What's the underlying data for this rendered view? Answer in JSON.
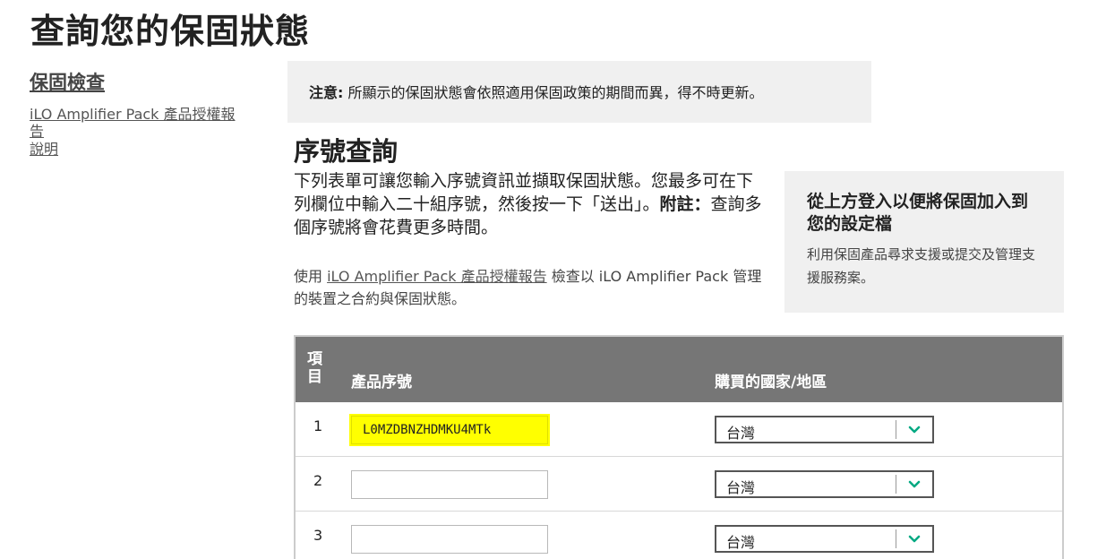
{
  "page": {
    "title": "查詢您的保固狀態"
  },
  "sidebar": {
    "heading": "保固檢查",
    "links": [
      "iLO Amplifier Pack 產品授權報告",
      "說明"
    ]
  },
  "notice": {
    "label": "注意:",
    "text": " 所顯示的保固狀態會依照適用保固政策的期間而異，得不時更新。"
  },
  "section": {
    "title": "序號查詢",
    "intro": "下列表單可讓您輸入序號資訊並擷取保固狀態。您最多可在下列欄位中輸入二十組序號，然後按一下「送出」。",
    "note_label": "附註：",
    "note_text": "查詢多個序號將會花費更多時間。",
    "ilo_prefix": "使用 ",
    "ilo_link": "iLO Amplifier Pack 產品授權報告",
    "ilo_suffix": " 檢查以 iLO Amplifier Pack 管理的裝置之合約與保固狀態。"
  },
  "login_box": {
    "title": "從上方登入以便將保固加入到您的設定檔",
    "description": "利用保固產品尋求支援或提交及管理支援服務案。"
  },
  "table": {
    "headers": {
      "item": "項目",
      "serial": "產品序號",
      "country": "購買的國家/地區"
    },
    "rows": [
      {
        "num": "1",
        "serial": "L0MZDBNZHDMKU4MTk",
        "country": "台灣",
        "highlighted": true
      },
      {
        "num": "2",
        "serial": "",
        "country": "台灣"
      },
      {
        "num": "3",
        "serial": "",
        "country": "台灣"
      }
    ]
  },
  "colors": {
    "header_bg": "#767676",
    "panel_bg": "#f0f0f0",
    "chevron": "#01a982",
    "highlight": "#ffff00"
  }
}
